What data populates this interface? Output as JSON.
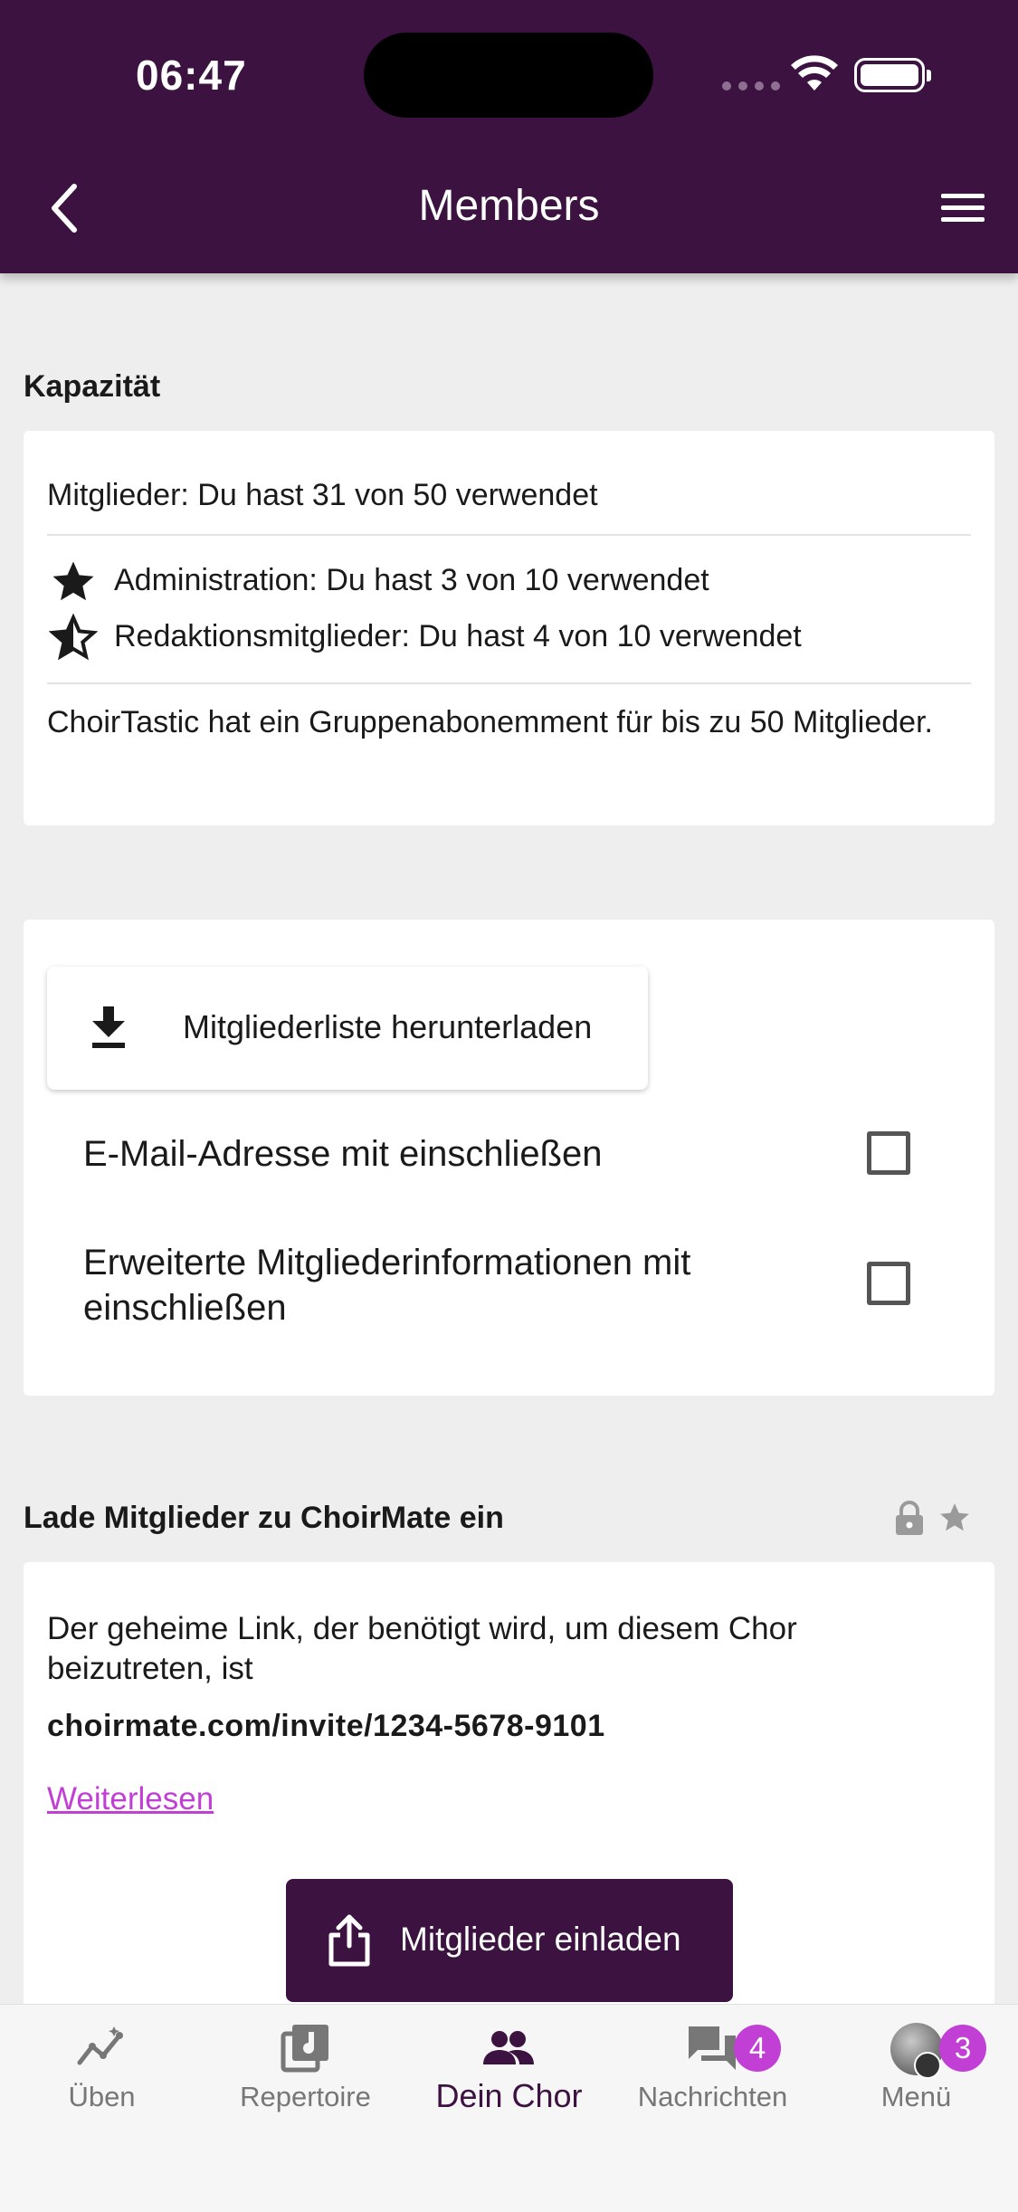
{
  "status_bar": {
    "time": "06:47"
  },
  "header": {
    "title": "Members"
  },
  "capacity": {
    "section_title": "Kapazität",
    "members_line": "Mitglieder: Du hast 31 von 50 verwendet",
    "admin_line": "Administration: Du hast 3 von 10 verwendet",
    "editors_line": "Redaktionsmitglieder: Du hast 4 von 10 verwendet",
    "subscription_text": "ChoirTastic hat ein Gruppenabonemment für bis zu 50 Mitglieder."
  },
  "download": {
    "button_label": "Mitgliederliste herunterladen",
    "option_email": "E-Mail-Adresse mit einschließen",
    "option_extended": "Erweiterte Mitgliederinformationen mit einschließen",
    "option_email_checked": false,
    "option_extended_checked": false
  },
  "invite": {
    "section_title": "Lade Mitglieder zu ChoirMate ein",
    "description": "Der geheime Link, der benötigt wird, um diesem Chor beizutreten, ist",
    "link": "choirmate.com/invite/1234-5678-9101",
    "read_more": "Weiterlesen",
    "button_label": "Mitglieder einladen"
  },
  "bottom_nav": {
    "items": [
      {
        "label": "Üben",
        "icon": "chart-line-icon"
      },
      {
        "label": "Repertoire",
        "icon": "music-library-icon"
      },
      {
        "label": "Dein Chor",
        "icon": "people-icon",
        "active": true
      },
      {
        "label": "Nachrichten",
        "icon": "chat-icon",
        "badge": "4"
      },
      {
        "label": "Menü",
        "icon": "avatar-icon",
        "badge": "3"
      }
    ]
  },
  "colors": {
    "brand": "#3b1240",
    "accent": "#c23fd6",
    "background": "#eeeeee"
  }
}
